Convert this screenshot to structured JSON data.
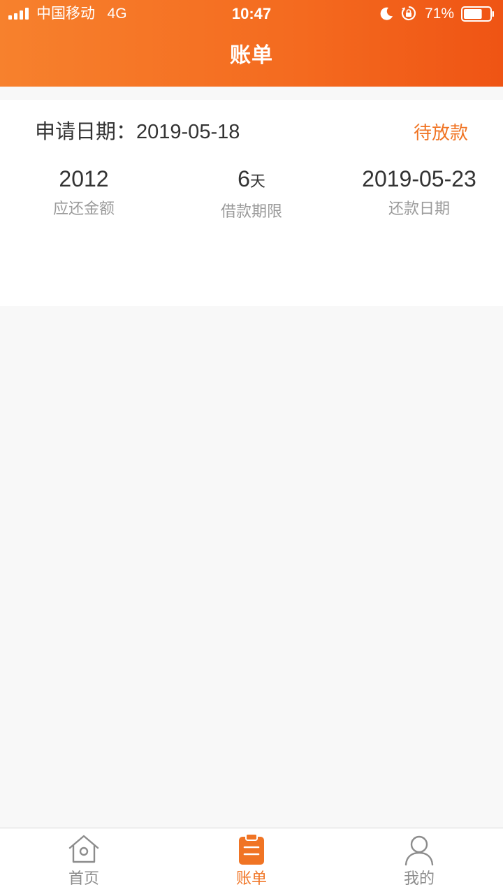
{
  "status_bar": {
    "carrier": "中国移动",
    "network": "4G",
    "time": "10:47",
    "battery_percent": "71%",
    "battery_level": 0.71,
    "icons": [
      "signal-icon",
      "moon-icon",
      "rotation-lock-icon",
      "battery-icon"
    ]
  },
  "nav": {
    "title": "账单"
  },
  "bill": {
    "apply_label": "申请日期：",
    "apply_date": "2019-05-18",
    "status": "待放款",
    "amount_value": "2012",
    "amount_label": "应还金额",
    "term_value": "6",
    "term_unit": "天",
    "term_label": "借款期限",
    "due_value": "2019-05-23",
    "due_label": "还款日期"
  },
  "tabbar": {
    "tabs": [
      {
        "label": "首页",
        "icon": "home-icon",
        "active": false
      },
      {
        "label": "账单",
        "icon": "bill-icon",
        "active": true
      },
      {
        "label": "我的",
        "icon": "user-icon",
        "active": false
      }
    ]
  },
  "colors": {
    "accent": "#f07424",
    "header_start": "#f7812d",
    "header_end": "#ef5414",
    "background": "#f8f8f8",
    "text_primary": "#333333",
    "text_secondary": "#9a9a9a"
  }
}
